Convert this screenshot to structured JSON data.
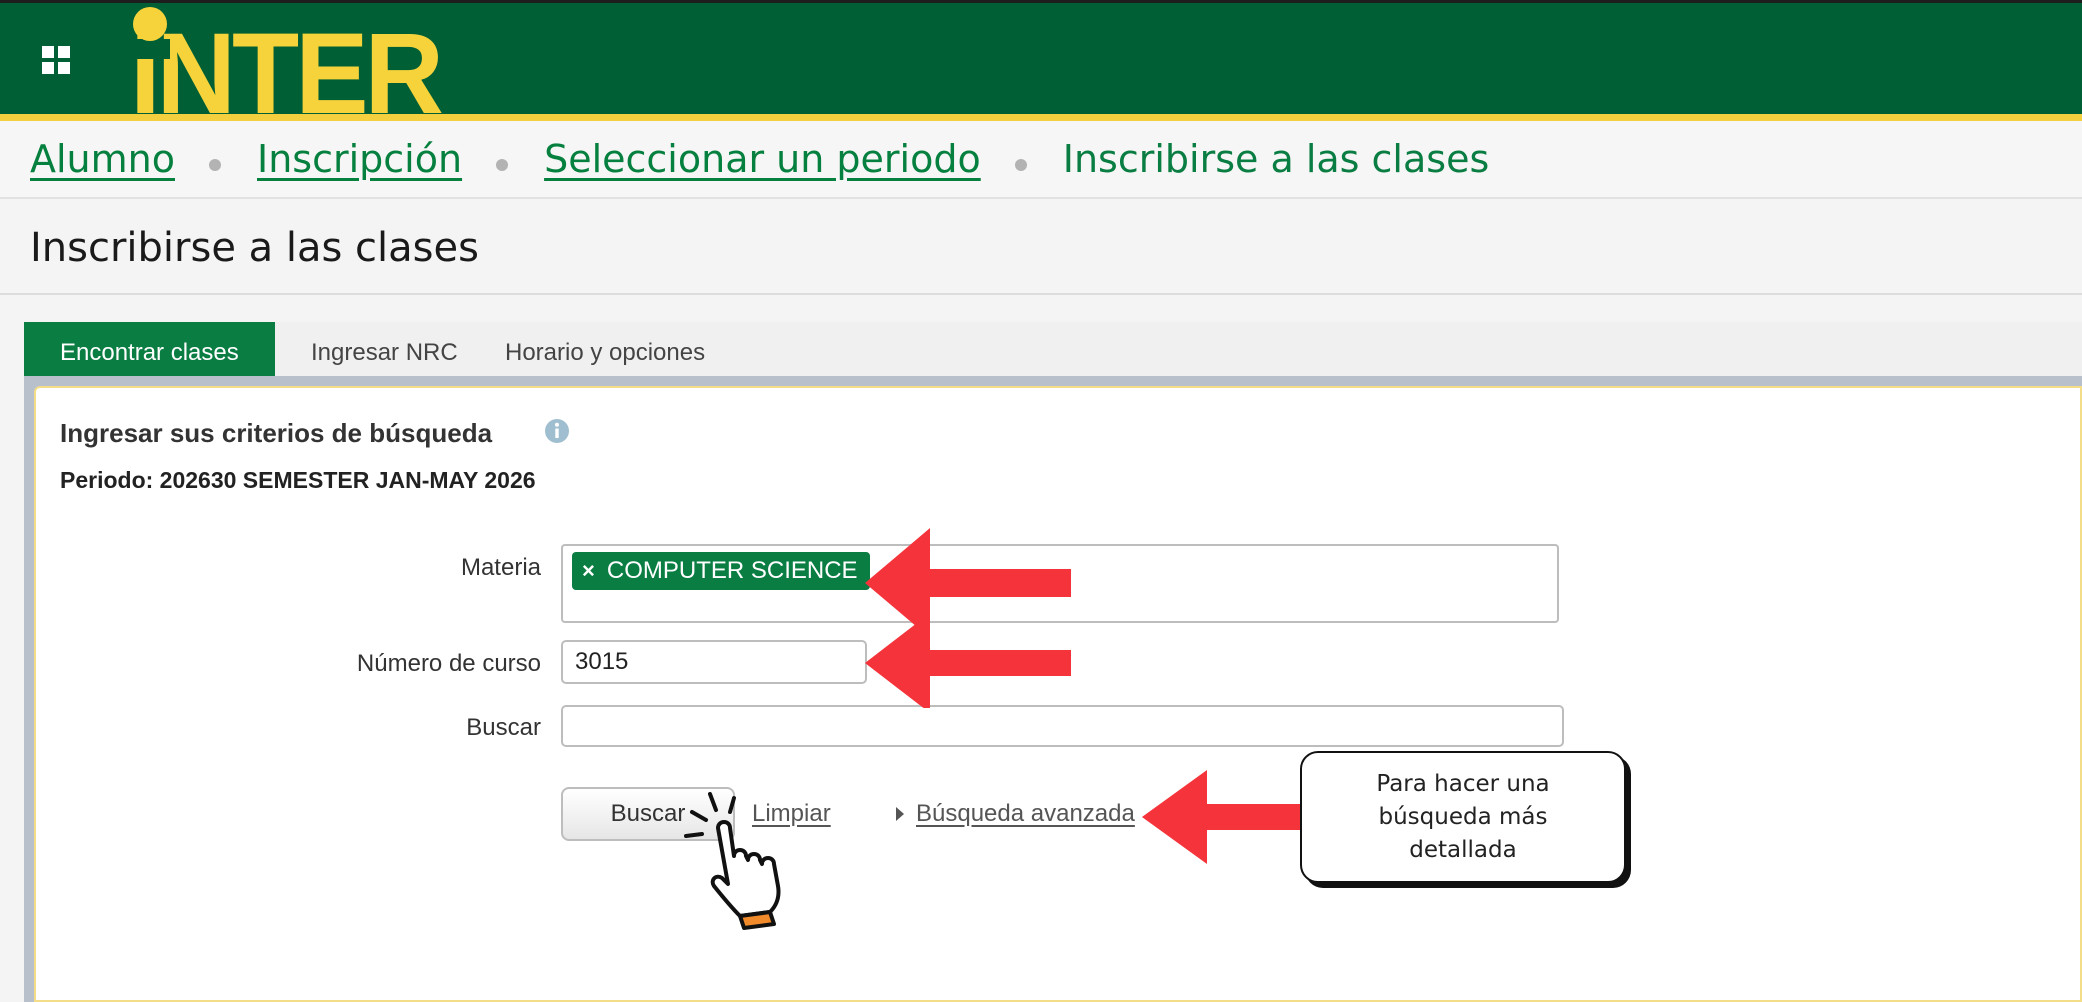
{
  "header": {
    "logo_text": "INTER",
    "apps_icon": "apps-grid-icon",
    "colors": {
      "primary": "#005f34",
      "accent": "#f7d33b",
      "active_tab": "#0a7d43"
    }
  },
  "breadcrumb": {
    "items": [
      {
        "label": "Alumno"
      },
      {
        "label": "Inscripción"
      },
      {
        "label": "Seleccionar un periodo"
      },
      {
        "label": "Inscribirse a las clases"
      }
    ]
  },
  "page": {
    "title": "Inscribirse a las clases"
  },
  "tabs": [
    {
      "label": "Encontrar clases",
      "active": true
    },
    {
      "label": "Ingresar NRC",
      "active": false
    },
    {
      "label": "Horario y opciones",
      "active": false
    }
  ],
  "search": {
    "heading": "Ingresar sus criterios de búsqueda",
    "period": "Periodo: 202630 SEMESTER JAN-MAY 2026",
    "materia_label": "Materia",
    "materia_chip": "COMPUTER SCIENCE",
    "materia_chip_remove": "×",
    "curso_label": "Número de curso",
    "curso_value": "3015",
    "buscar_label": "Buscar",
    "buscar_value": "",
    "buscar_button": "Buscar",
    "limpiar": "Limpiar",
    "advanced": "Búsqueda avanzada"
  },
  "annotations": {
    "callout": "Para hacer una búsqueda más detallada",
    "arrow_color": "#f5333a"
  }
}
